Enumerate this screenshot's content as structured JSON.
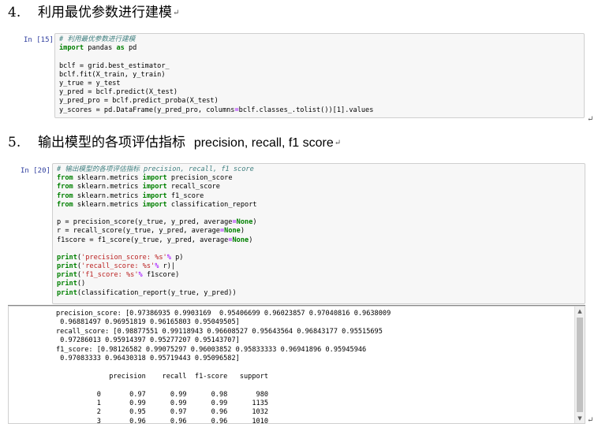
{
  "section4": {
    "number": "4.",
    "title": "利用最优参数进行建模",
    "mark": "↵"
  },
  "cell15": {
    "prompt": "In [15]:",
    "lines": [
      [
        {
          "t": "# 利用最优参数进行建模",
          "c": "cmt"
        }
      ],
      [
        {
          "t": "import",
          "c": "kw"
        },
        {
          "t": " pandas "
        },
        {
          "t": "as",
          "c": "kw"
        },
        {
          "t": " pd"
        }
      ],
      [],
      [
        {
          "t": "bclf = grid.best_estimator_"
        }
      ],
      [
        {
          "t": "bclf.fit(X_train, y_train)"
        }
      ],
      [
        {
          "t": "y_true = y_test"
        }
      ],
      [
        {
          "t": "y_pred = bclf.predict(X_test)"
        }
      ],
      [
        {
          "t": "y_pred_pro = bclf.predict_proba(X_test)"
        }
      ],
      [
        {
          "t": "y_scores = pd.DataFrame(y_pred_pro, columns"
        },
        {
          "t": "=",
          "c": "op"
        },
        {
          "t": "bclf.classes_.tolist())[1].values"
        }
      ]
    ],
    "trailing_mark": "↵"
  },
  "section5": {
    "number": "5.",
    "title": "输出模型的各项评估指标",
    "subtitle": "precision, recall, f1 score",
    "mark": "↵"
  },
  "cell20": {
    "prompt": "In [20]:",
    "lines": [
      [
        {
          "t": "# 输出模型的各项评估指标 precision, recall, f1 score",
          "c": "cmt"
        }
      ],
      [
        {
          "t": "from",
          "c": "kw"
        },
        {
          "t": " sklearn.metrics "
        },
        {
          "t": "import",
          "c": "kw"
        },
        {
          "t": " precision_score"
        }
      ],
      [
        {
          "t": "from",
          "c": "kw"
        },
        {
          "t": " sklearn.metrics "
        },
        {
          "t": "import",
          "c": "kw"
        },
        {
          "t": " recall_score"
        }
      ],
      [
        {
          "t": "from",
          "c": "kw"
        },
        {
          "t": " sklearn.metrics "
        },
        {
          "t": "import",
          "c": "kw"
        },
        {
          "t": " f1_score"
        }
      ],
      [
        {
          "t": "from",
          "c": "kw"
        },
        {
          "t": " sklearn.metrics "
        },
        {
          "t": "import",
          "c": "kw"
        },
        {
          "t": " classification_report"
        }
      ],
      [],
      [
        {
          "t": "p = precision_score(y_true, y_pred, average"
        },
        {
          "t": "=",
          "c": "op"
        },
        {
          "t": "None",
          "c": "nm"
        },
        {
          "t": ")"
        }
      ],
      [
        {
          "t": "r = recall_score(y_true, y_pred, average"
        },
        {
          "t": "=",
          "c": "op"
        },
        {
          "t": "None",
          "c": "nm"
        },
        {
          "t": ")"
        }
      ],
      [
        {
          "t": "f1score = f1_score(y_true, y_pred, average"
        },
        {
          "t": "=",
          "c": "op"
        },
        {
          "t": "None",
          "c": "nm"
        },
        {
          "t": ")"
        }
      ],
      [],
      [
        {
          "t": "print",
          "c": "nm"
        },
        {
          "t": "("
        },
        {
          "t": "'precision_score: %s'",
          "c": "str"
        },
        {
          "t": "%",
          "c": "op"
        },
        {
          "t": " p)"
        }
      ],
      [
        {
          "t": "print",
          "c": "nm"
        },
        {
          "t": "("
        },
        {
          "t": "'recall_score: %s'",
          "c": "str"
        },
        {
          "t": "%",
          "c": "op"
        },
        {
          "t": " r)|"
        }
      ],
      [
        {
          "t": "print",
          "c": "nm"
        },
        {
          "t": "("
        },
        {
          "t": "'f1_score: %s'",
          "c": "str"
        },
        {
          "t": "%",
          "c": "op"
        },
        {
          "t": " f1score)"
        }
      ],
      [
        {
          "t": "print",
          "c": "nm"
        },
        {
          "t": "()"
        }
      ],
      [
        {
          "t": "print",
          "c": "nm"
        },
        {
          "t": "(classification_report(y_true, y_pred))"
        }
      ]
    ]
  },
  "output": {
    "lines": [
      "precision_score: [0.97386935 0.9903169  0.95406699 0.96023857 0.97040816 0.9638009",
      " 0.96881497 0.96951819 0.96165803 0.95049505]",
      "recall_score: [0.98877551 0.99118943 0.96608527 0.95643564 0.96843177 0.95515695",
      " 0.97286013 0.95914397 0.95277207 0.95143707]",
      "f1_score: [0.98126582 0.99075297 0.96003852 0.95833333 0.96941896 0.95945946",
      " 0.97083333 0.96430318 0.95719443 0.95096582]",
      "",
      "             precision    recall  f1-score   support",
      "",
      "          0       0.97      0.99      0.98       980",
      "          1       0.99      0.99      0.99      1135",
      "          2       0.95      0.97      0.96      1032",
      "          3       0.96      0.96      0.96      1010"
    ],
    "scroll_up_glyph": "▲",
    "scroll_down_glyph": "▼",
    "trailing_mark": "↵"
  }
}
